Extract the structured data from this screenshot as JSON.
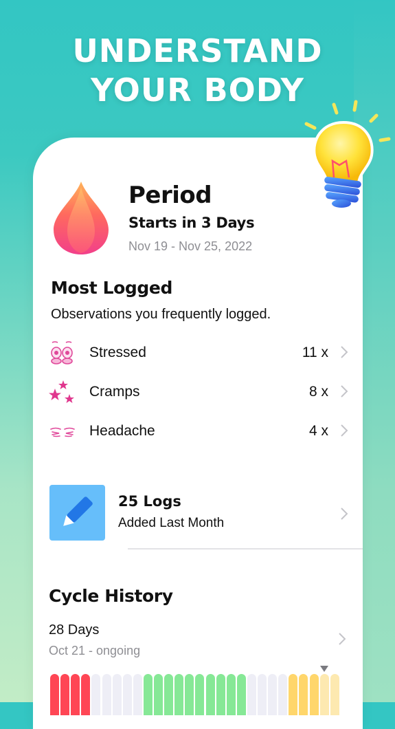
{
  "headline": {
    "line1": "UNDERSTAND",
    "line2": "YOUR BODY"
  },
  "period": {
    "title": "Period",
    "subtitle": "Starts in 3 Days",
    "dates": "Nov 19 - Nov 25, 2022",
    "icon": "blood-drop-icon"
  },
  "most_logged": {
    "title": "Most Logged",
    "subtitle": "Observations you frequently logged.",
    "items": [
      {
        "label": "Stressed",
        "count": "11 x",
        "icon": "stressed-face-icon"
      },
      {
        "label": "Cramps",
        "count": "8 x",
        "icon": "cramps-stars-icon"
      },
      {
        "label": "Headache",
        "count": "4 x",
        "icon": "headache-icon"
      }
    ]
  },
  "logs": {
    "title": "25 Logs",
    "subtitle": "Added Last Month",
    "icon": "pencil-icon"
  },
  "cycle_history": {
    "title": "Cycle History",
    "days": "28 Days",
    "range": "Oct 21 - ongoing",
    "current_day": 27,
    "phases": [
      "period",
      "period",
      "period",
      "period",
      "none",
      "none",
      "none",
      "none",
      "none",
      "fertile",
      "fertile",
      "fertile",
      "fertile",
      "fertile",
      "fertile",
      "fertile",
      "fertile",
      "fertile",
      "fertile",
      "none",
      "none",
      "none",
      "none",
      "pms",
      "pms",
      "pms",
      "pms-future",
      "pms-future"
    ],
    "colors": {
      "period": "#ff4655",
      "none": "#eeeef6",
      "fertile": "#86e896",
      "pms": "#ffd66b",
      "pms-future": "#fde9b0"
    }
  }
}
